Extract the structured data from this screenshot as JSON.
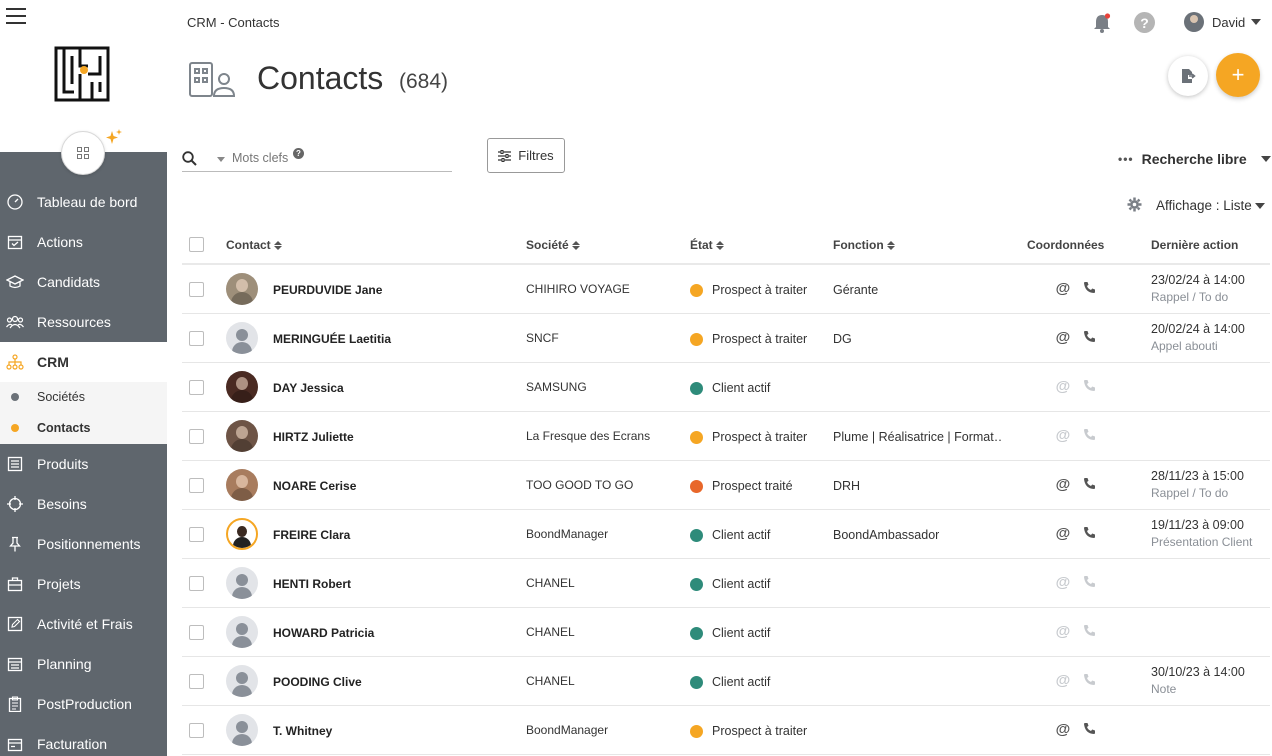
{
  "header": {
    "breadcrumb": "CRM - Contacts",
    "user_name": "David"
  },
  "page": {
    "title": "Contacts",
    "count": "(684)"
  },
  "search": {
    "placeholder": "Mots clefs",
    "help": "?",
    "filters_label": "Filtres",
    "free_search_label": "Recherche libre",
    "display_mode_label": "Affichage : Liste"
  },
  "buttons": {
    "add_label": "+",
    "help_label": "?"
  },
  "sidebar": {
    "items": [
      {
        "label": "Tableau de bord",
        "icon": "dashboard-icon"
      },
      {
        "label": "Actions",
        "icon": "calendar-check-icon"
      },
      {
        "label": "Candidats",
        "icon": "graduation-cap-icon"
      },
      {
        "label": "Ressources",
        "icon": "people-icon"
      },
      {
        "label": "CRM",
        "icon": "org-chart-icon",
        "active": true
      },
      {
        "label": "Produits",
        "icon": "list-icon"
      },
      {
        "label": "Besoins",
        "icon": "target-icon"
      },
      {
        "label": "Positionnements",
        "icon": "pin-icon"
      },
      {
        "label": "Projets",
        "icon": "briefcase-icon"
      },
      {
        "label": "Activité et Frais",
        "icon": "edit-icon"
      },
      {
        "label": "Planning",
        "icon": "calendar-icon"
      },
      {
        "label": "PostProduction",
        "icon": "clipboard-icon"
      },
      {
        "label": "Facturation",
        "icon": "invoice-icon"
      }
    ],
    "sub_items": [
      {
        "label": "Sociétés",
        "dot_color": "#6b7178"
      },
      {
        "label": "Contacts",
        "dot_color": "#f5a623",
        "active": true
      }
    ]
  },
  "table": {
    "headers": {
      "contact": "Contact",
      "company": "Société",
      "state": "État",
      "function": "Fonction",
      "coordinates": "Coordonnées",
      "last_action": "Dernière action"
    },
    "rows": [
      {
        "name": "PEURDUVIDE Jane",
        "company": "CHIHIRO VOYAGE",
        "state": "Prospect à traiter",
        "state_color": "#f5a623",
        "function": "Gérante",
        "coords_active": true,
        "last_date": "23/02/24 à 14:00",
        "last_type": "Rappel / To do",
        "avatar": "photo",
        "avatar_color": "#9e8f7a"
      },
      {
        "name": "MERINGUÉE Laetitia",
        "company": "SNCF",
        "state": "Prospect à traiter",
        "state_color": "#f5a623",
        "function": "DG",
        "coords_active": true,
        "last_date": "20/02/24 à 14:00",
        "last_type": "Appel abouti",
        "avatar": "default"
      },
      {
        "name": "DAY Jessica",
        "company": "SAMSUNG",
        "state": "Client actif",
        "state_color": "#2e8b7a",
        "function": "",
        "coords_active": false,
        "last_date": "",
        "last_type": "",
        "avatar": "photo",
        "avatar_color": "#4a2a22"
      },
      {
        "name": "HIRTZ Juliette",
        "company": "La Fresque des Ecrans",
        "state": "Prospect à traiter",
        "state_color": "#f5a623",
        "function": "Plume | Réalisatrice | Format…",
        "coords_active": false,
        "last_date": "",
        "last_type": "",
        "avatar": "photo",
        "avatar_color": "#6e5446"
      },
      {
        "name": "NOARE Cerise",
        "company": "TOO GOOD TO GO",
        "state": "Prospect traité",
        "state_color": "#e8672a",
        "function": "DRH",
        "coords_active": true,
        "last_date": "28/11/23 à 15:00",
        "last_type": "Rappel / To do",
        "avatar": "photo",
        "avatar_color": "#a87c5e"
      },
      {
        "name": "FREIRE Clara",
        "company": "BoondManager",
        "state": "Client actif",
        "state_color": "#2e8b7a",
        "function": "BoondAmbassador",
        "coords_active": true,
        "last_date": "19/11/23 à 09:00",
        "last_type": "Présentation Client",
        "avatar": "ring"
      },
      {
        "name": "HENTI Robert",
        "company": "CHANEL",
        "state": "Client actif",
        "state_color": "#2e8b7a",
        "function": "",
        "coords_active": false,
        "last_date": "",
        "last_type": "",
        "avatar": "default"
      },
      {
        "name": "HOWARD Patricia",
        "company": "CHANEL",
        "state": "Client actif",
        "state_color": "#2e8b7a",
        "function": "",
        "coords_active": false,
        "last_date": "",
        "last_type": "",
        "avatar": "default"
      },
      {
        "name": "POODING Clive",
        "company": "CHANEL",
        "state": "Client actif",
        "state_color": "#2e8b7a",
        "function": "",
        "coords_active": false,
        "last_date": "30/10/23 à 14:00",
        "last_type": "Note",
        "avatar": "default"
      },
      {
        "name": "T. Whitney",
        "company": "BoondManager",
        "state": "Prospect à traiter",
        "state_color": "#f5a623",
        "function": "",
        "coords_active": true,
        "last_date": "",
        "last_type": "",
        "avatar": "default"
      }
    ]
  },
  "colors": {
    "accent": "#f5a623",
    "sidebar_bg": "#5f666d",
    "client_actif": "#2e8b7a",
    "prospect_traite": "#e8672a"
  }
}
